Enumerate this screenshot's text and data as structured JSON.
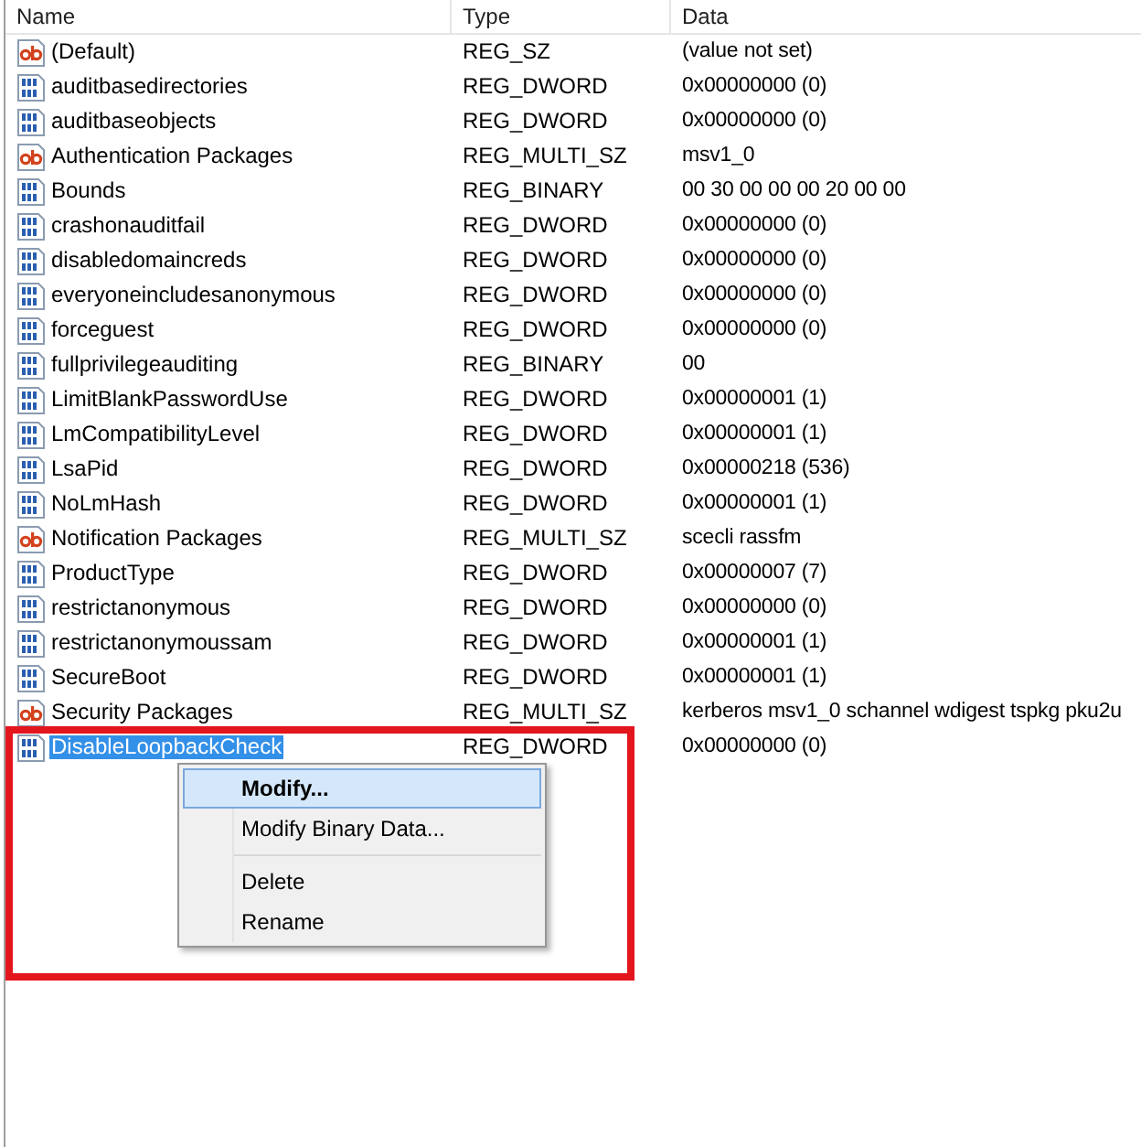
{
  "columns": [
    "Name",
    "Type",
    "Data"
  ],
  "rows": [
    {
      "kind": "string",
      "name": "(Default)",
      "type": "REG_SZ",
      "data": "(value not set)",
      "selected": false
    },
    {
      "kind": "binary",
      "name": "auditbasedirectories",
      "type": "REG_DWORD",
      "data": "0x00000000 (0)",
      "selected": false
    },
    {
      "kind": "binary",
      "name": "auditbaseobjects",
      "type": "REG_DWORD",
      "data": "0x00000000 (0)",
      "selected": false
    },
    {
      "kind": "string",
      "name": "Authentication Packages",
      "type": "REG_MULTI_SZ",
      "data": "msv1_0",
      "selected": false
    },
    {
      "kind": "binary",
      "name": "Bounds",
      "type": "REG_BINARY",
      "data": "00 30 00 00 00 20 00 00",
      "selected": false
    },
    {
      "kind": "binary",
      "name": "crashonauditfail",
      "type": "REG_DWORD",
      "data": "0x00000000 (0)",
      "selected": false
    },
    {
      "kind": "binary",
      "name": "disabledomaincreds",
      "type": "REG_DWORD",
      "data": "0x00000000 (0)",
      "selected": false
    },
    {
      "kind": "binary",
      "name": "everyoneincludesanonymous",
      "type": "REG_DWORD",
      "data": "0x00000000 (0)",
      "selected": false
    },
    {
      "kind": "binary",
      "name": "forceguest",
      "type": "REG_DWORD",
      "data": "0x00000000 (0)",
      "selected": false
    },
    {
      "kind": "binary",
      "name": "fullprivilegeauditing",
      "type": "REG_BINARY",
      "data": "00",
      "selected": false
    },
    {
      "kind": "binary",
      "name": "LimitBlankPasswordUse",
      "type": "REG_DWORD",
      "data": "0x00000001 (1)",
      "selected": false
    },
    {
      "kind": "binary",
      "name": "LmCompatibilityLevel",
      "type": "REG_DWORD",
      "data": "0x00000001 (1)",
      "selected": false
    },
    {
      "kind": "binary",
      "name": "LsaPid",
      "type": "REG_DWORD",
      "data": "0x00000218 (536)",
      "selected": false
    },
    {
      "kind": "binary",
      "name": "NoLmHash",
      "type": "REG_DWORD",
      "data": "0x00000001 (1)",
      "selected": false
    },
    {
      "kind": "string",
      "name": "Notification Packages",
      "type": "REG_MULTI_SZ",
      "data": "scecli rassfm",
      "selected": false
    },
    {
      "kind": "binary",
      "name": "ProductType",
      "type": "REG_DWORD",
      "data": "0x00000007 (7)",
      "selected": false
    },
    {
      "kind": "binary",
      "name": "restrictanonymous",
      "type": "REG_DWORD",
      "data": "0x00000000 (0)",
      "selected": false
    },
    {
      "kind": "binary",
      "name": "restrictanonymoussam",
      "type": "REG_DWORD",
      "data": "0x00000001 (1)",
      "selected": false
    },
    {
      "kind": "binary",
      "name": "SecureBoot",
      "type": "REG_DWORD",
      "data": "0x00000001 (1)",
      "selected": false
    },
    {
      "kind": "string",
      "name": "Security Packages",
      "type": "REG_MULTI_SZ",
      "data": "kerberos msv1_0 schannel wdigest tspkg pku2u",
      "selected": false
    },
    {
      "kind": "binary",
      "name": "DisableLoopbackCheck",
      "type": "REG_DWORD",
      "data": "0x00000000 (0)",
      "selected": true
    }
  ],
  "context_menu": [
    {
      "kind": "item",
      "label": "Modify...",
      "selected": true,
      "default": true
    },
    {
      "kind": "item",
      "label": "Modify Binary Data...",
      "selected": false,
      "default": false
    },
    {
      "kind": "separator"
    },
    {
      "kind": "item",
      "label": "Delete",
      "selected": false,
      "default": false
    },
    {
      "kind": "item",
      "label": "Rename",
      "selected": false,
      "default": false
    }
  ],
  "highlight_frame": {
    "color": "#e3161e"
  }
}
